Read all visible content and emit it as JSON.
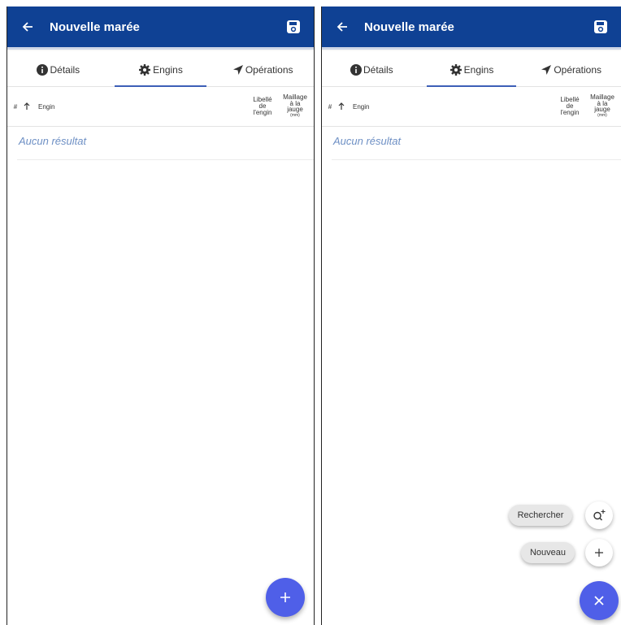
{
  "header": {
    "title": "Nouvelle marée"
  },
  "tabs": [
    {
      "label": "Détails"
    },
    {
      "label": "Engins"
    },
    {
      "label": "Opérations"
    }
  ],
  "table": {
    "columns": {
      "hash": "#",
      "engin": "Engin",
      "libelle": [
        "Libellé",
        "de",
        "l'engin"
      ],
      "maillage": [
        "Maillage",
        "à la",
        "jauge"
      ],
      "maillage_unit": "(mm)"
    },
    "empty_text": "Aucun résultat"
  },
  "fab_menu": {
    "search_label": "Rechercher",
    "new_label": "Nouveau"
  },
  "colors": {
    "toolbar": "#0f4194",
    "fab": "#4f5fe8",
    "empty_text": "#6d8fc4",
    "tab_indicator": "#3d5fb7"
  },
  "icons": {
    "back": "arrow-left-icon",
    "save": "save-icon",
    "details": "info-circle-icon",
    "engins": "gear-icon",
    "operations": "navigation-arrow-icon",
    "sort": "arrow-up-icon",
    "add": "plus-icon",
    "search_add": "search-plus-icon",
    "close": "close-icon"
  }
}
